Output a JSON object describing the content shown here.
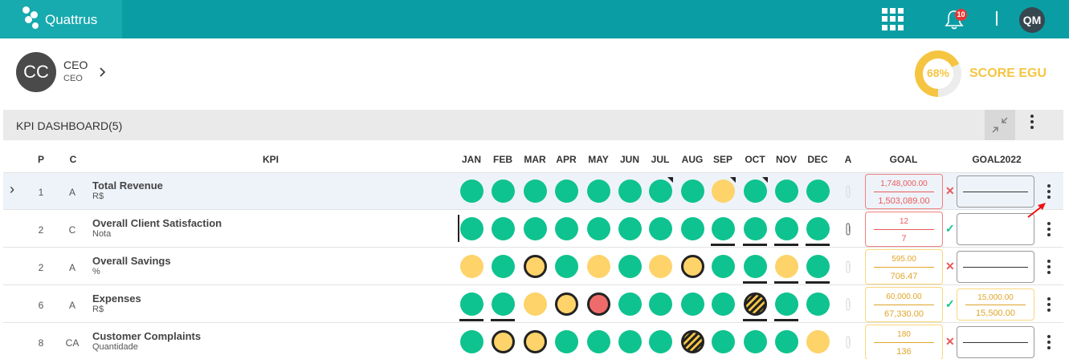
{
  "app": {
    "name": "Quattrus",
    "notification_count": "10",
    "user_initials": "QM"
  },
  "profile": {
    "initials": "CC",
    "role": "CEO",
    "sub": "CEO"
  },
  "score": {
    "percent": "68%",
    "value": 0.68,
    "label": "SCORE EGU"
  },
  "panel": {
    "title": "KPI DASHBOARD(5)"
  },
  "columns": {
    "p": "P",
    "c": "C",
    "kpi": "KPI",
    "months": [
      "JAN",
      "FEB",
      "MAR",
      "APR",
      "MAY",
      "JUN",
      "JUL",
      "AUG",
      "SEP",
      "OCT",
      "NOV",
      "DEC"
    ],
    "a": "A",
    "goal": "GOAL",
    "goal2022": "GOAL2022"
  },
  "rows": [
    {
      "p": "1",
      "c": "A",
      "name": "Total Revenue",
      "unit": "R$",
      "goal1": "1,748,000.00",
      "goal2": "1,503,089.00",
      "status": "✕",
      "goal_color": "red",
      "goal2022": null
    },
    {
      "p": "2",
      "c": "C",
      "name": "Overall Client Satisfaction",
      "unit": "Nota",
      "goal1": "12",
      "goal2": "7",
      "status": "✓",
      "goal_color": "red",
      "goal2022": null
    },
    {
      "p": "2",
      "c": "A",
      "name": "Overall Savings",
      "unit": "%",
      "goal1": "595.00",
      "goal2": "706.47",
      "status": "✕",
      "goal_color": "yellow",
      "goal2022": null
    },
    {
      "p": "6",
      "c": "A",
      "name": "Expenses",
      "unit": "R$",
      "goal1": "60,000.00",
      "goal2": "67,330.00",
      "status": "✓",
      "goal_color": "yellow",
      "goal2022": [
        "15,000.00",
        "15,500.00"
      ]
    },
    {
      "p": "8",
      "c": "CA",
      "name": "Customer Complaints",
      "unit": "Quantidade",
      "goal1": "180",
      "goal2": "136",
      "status": "✕",
      "goal_color": "yellow",
      "goal2022": null
    }
  ],
  "status_grid": [
    [
      "green",
      "green",
      "green",
      "green",
      "green",
      "green",
      "green-flag",
      "green",
      "yellow-flag",
      "green-flag",
      "green",
      "green"
    ],
    [
      "green",
      "green",
      "green",
      "green",
      "green",
      "green",
      "green",
      "green",
      "green-ul",
      "green-ul",
      "green-ul",
      "green-ul"
    ],
    [
      "yellow",
      "green",
      "yellow-ring",
      "green",
      "yellow",
      "green",
      "yellow",
      "yellow-ring",
      "green",
      "green-ul",
      "yellow-ul",
      "green-ul"
    ],
    [
      "green-ul",
      "green-ul",
      "yellow",
      "yellow-ring",
      "red-ring",
      "green",
      "green",
      "green",
      "green",
      "hatch-ul",
      "green-ul",
      "green"
    ],
    [
      "green",
      "yellow-ring",
      "yellow-ring",
      "green",
      "green",
      "green",
      "green",
      "hatch",
      "green",
      "green",
      "green",
      "yellow"
    ]
  ],
  "colors": {
    "topbar": "#0a9ea4",
    "green": "#0ec38f",
    "yellow": "#fdd36a",
    "red": "#ef6b6b",
    "score": "#f5c542"
  },
  "icons": [
    "apps-grid-icon",
    "bell-icon",
    "chevron-right-icon",
    "collapse-icon",
    "more-vertical-icon",
    "paperclip-icon",
    "check-icon",
    "close-icon",
    "arrow-pointer-icon"
  ]
}
